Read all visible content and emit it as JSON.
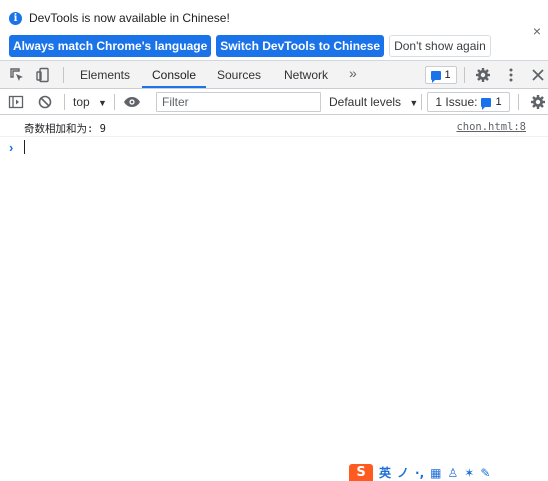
{
  "infobar": {
    "icon": "info-icon",
    "message": "DevTools is now available in Chinese!",
    "buttons": {
      "always_match": "Always match Chrome's language",
      "switch_chinese": "Switch DevTools to Chinese",
      "dont_show": "Don't show again"
    },
    "close_glyph": "×"
  },
  "tabbar": {
    "tabs": [
      {
        "label": "Elements"
      },
      {
        "label": "Console"
      },
      {
        "label": "Sources"
      },
      {
        "label": "Network"
      }
    ],
    "active_tab": "Console",
    "more_glyph": "»",
    "issues_count": "1"
  },
  "console_toolbar": {
    "context": "top",
    "filter_placeholder": "Filter",
    "levels": "Default levels",
    "issue_label": "1 Issue:",
    "issue_count": "1"
  },
  "console": {
    "messages": [
      {
        "text": "奇数相加和为: 9",
        "source": "chon.html:8"
      }
    ],
    "prompt_glyph": "›"
  },
  "ime": {
    "logo": "S",
    "items": [
      "英",
      "ノ",
      "·,",
      "▦",
      "♙",
      "✶",
      "✎"
    ]
  },
  "colors": {
    "accent": "#1a73e8",
    "ime_brand": "#ff5a1f"
  }
}
